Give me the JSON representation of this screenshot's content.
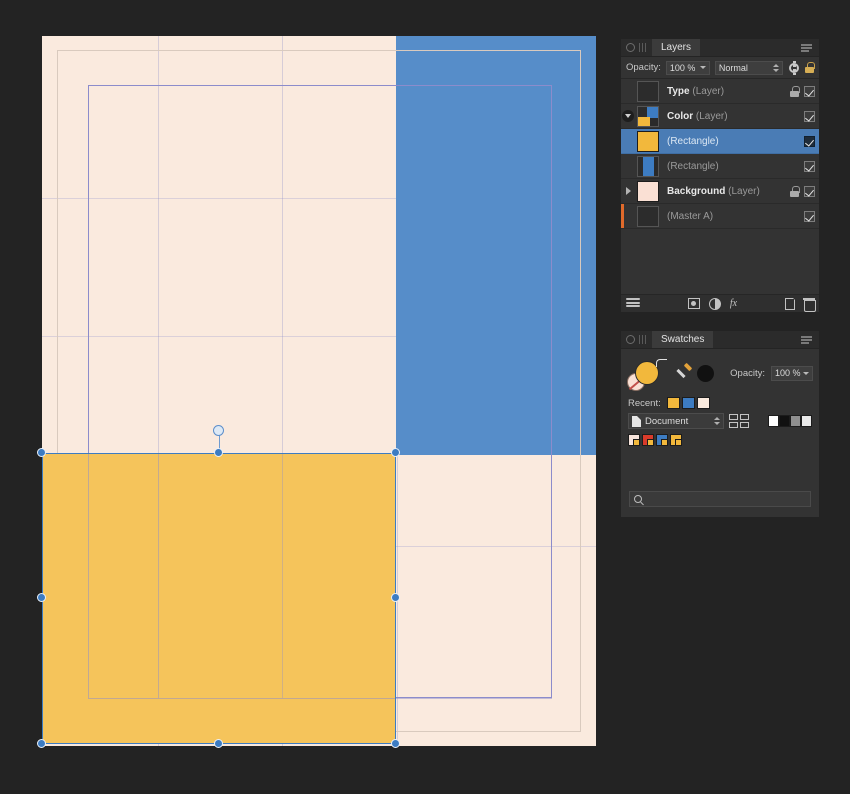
{
  "canvas": {
    "page_bg": "#faeade",
    "blue_rect_color": "#3d7cc2",
    "yellow_rect_color": "#f2b42e",
    "guide_color": "#8c8ccb",
    "bleed_color": "#d9cabe",
    "selection_color": "#3d7cc2",
    "workspace_bg": "#232323"
  },
  "layers_panel": {
    "tab_label": "Layers",
    "opacity_label": "Opacity:",
    "opacity_value": "100 %",
    "blend_mode": "Normal",
    "rows": [
      {
        "name": "Type",
        "kind": "(Layer)",
        "bold": true,
        "locked": true,
        "visible": true,
        "selected": false,
        "disclosure": "none",
        "thumb": "dark",
        "stripe": ""
      },
      {
        "name": "Color",
        "kind": "(Layer)",
        "bold": true,
        "locked": false,
        "visible": true,
        "selected": false,
        "disclosure": "open",
        "thumb": "color-grp",
        "stripe": ""
      },
      {
        "name": "",
        "kind": "(Rectangle)",
        "bold": false,
        "locked": false,
        "visible": true,
        "selected": true,
        "disclosure": "none",
        "thumb": "yellow",
        "stripe": ""
      },
      {
        "name": "",
        "kind": "(Rectangle)",
        "bold": false,
        "locked": false,
        "visible": true,
        "selected": false,
        "disclosure": "none",
        "thumb": "blue",
        "stripe": ""
      },
      {
        "name": "Background",
        "kind": "(Layer)",
        "bold": true,
        "locked": true,
        "visible": true,
        "selected": false,
        "disclosure": "closed",
        "thumb": "cream",
        "stripe": ""
      },
      {
        "name": "",
        "kind": "(Master A)",
        "bold": false,
        "locked": false,
        "visible": true,
        "selected": false,
        "disclosure": "none",
        "thumb": "dark",
        "stripe": "#e06a2b"
      }
    ],
    "bottom_icons": [
      "layers-stack-icon",
      "mask-icon",
      "adjustment-icon",
      "fx-icon",
      "new-layer-icon",
      "delete-layer-icon"
    ]
  },
  "swatches_panel": {
    "tab_label": "Swatches",
    "fill_color": "#f2b83c",
    "stroke_color": "#fae0d4",
    "opacity_label": "Opacity:",
    "opacity_value": "100 %",
    "recent_label": "Recent:",
    "recent_colors": [
      "#f2b83c",
      "#3d7cc2",
      "#faeade"
    ],
    "palette_select": "Document",
    "mini_chips": [
      "#ffffff",
      "#111111",
      "#8f8f8f",
      "#e9e9e9"
    ],
    "document_swatches": [
      "#f7e4dc",
      "#d93b2b",
      "#3d7cc2",
      "#f2b83c"
    ],
    "search_placeholder": ""
  }
}
